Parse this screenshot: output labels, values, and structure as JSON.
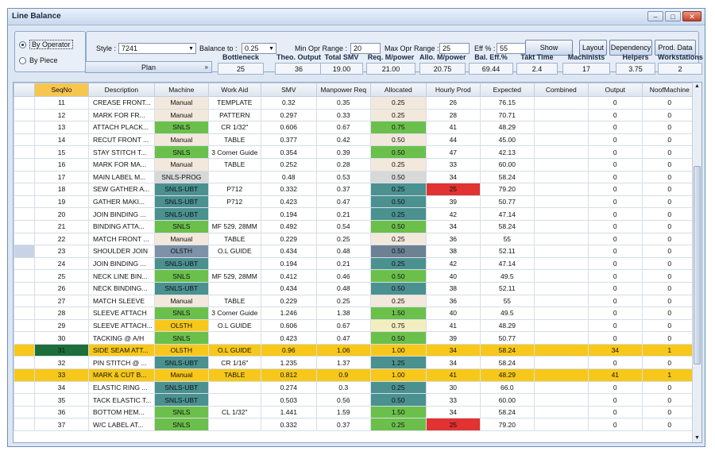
{
  "window": {
    "title": "Line Balance",
    "min": "–",
    "max": "□",
    "close": "✕"
  },
  "mode": {
    "op": "By Operator",
    "piece": "By Piece"
  },
  "filters": {
    "style_label": "Style :",
    "style_value": "7241",
    "balance_label": "Balance to :",
    "balance_value": "0.25",
    "min_label": "Min Opr Range :",
    "min_value": "20",
    "max_label": "Max Opr Range :",
    "max_value": "25",
    "eff_label": "Eff % :",
    "eff_value": "55",
    "show": "Show",
    "layout": "Layout",
    "dependency": "Dependency",
    "prod_data": "Prod. Data"
  },
  "plan": {
    "label": "Plan",
    "chev": "»"
  },
  "stats": [
    {
      "label": "Bottleneck",
      "value": "25"
    },
    {
      "label": "Theo. Output",
      "value": "36"
    },
    {
      "label": "Total SMV",
      "value": "19.00"
    },
    {
      "label": "Req. M/power",
      "value": "21.00"
    },
    {
      "label": "Allo. M/power",
      "value": "20.75"
    },
    {
      "label": "Bal. Eff.%",
      "value": "69.44"
    },
    {
      "label": "Takt Time",
      "value": "2.4"
    },
    {
      "label": "Machinists",
      "value": "17"
    },
    {
      "label": "Helpers",
      "value": "3.75"
    },
    {
      "label": "Workstations",
      "value": "2"
    }
  ],
  "columns": [
    "SeqNo",
    "Description",
    "Machine",
    "Work Aid",
    "SMV",
    "Manpower Req",
    "Allocated",
    "Hourly Prod",
    "Expected",
    "Combined",
    "Output",
    "NoofMachine"
  ],
  "rows": [
    [
      "11",
      "CREASE FRONT...",
      "Manual",
      "TEMPLATE",
      "0.32",
      "0.35",
      "0.25",
      "26",
      "76.15",
      "",
      "0",
      "0"
    ],
    [
      "12",
      "MARK FOR FR...",
      "Manual",
      "PATTERN",
      "0.297",
      "0.33",
      "0.25",
      "28",
      "70.71",
      "",
      "0",
      "0"
    ],
    [
      "13",
      "ATTACH PLACK...",
      "SNLS",
      "CR 1/32\"",
      "0.606",
      "0.67",
      "0.75",
      "41",
      "48.29",
      "",
      "0",
      "0"
    ],
    [
      "14",
      "RECUT FRONT ...",
      "Manual",
      "TABLE",
      "0.377",
      "0.42",
      "0.50",
      "44",
      "45.00",
      "",
      "0",
      "0"
    ],
    [
      "15",
      "STAY STITCH T...",
      "SNLS",
      "3 Corner Guide",
      "0.354",
      "0.39",
      "0.50",
      "47",
      "42.13",
      "",
      "0",
      "0"
    ],
    [
      "16",
      "MARK FOR MA...",
      "Manual",
      "TABLE",
      "0.252",
      "0.28",
      "0.25",
      "33",
      "60.00",
      "",
      "0",
      "0"
    ],
    [
      "17",
      "MAIN LABEL M...",
      "SNLS-PROG",
      "",
      "0.48",
      "0.53",
      "0.50",
      "34",
      "58.24",
      "",
      "0",
      "0"
    ],
    [
      "18",
      "SEW GATHER A...",
      "SNLS-UBT",
      "P712",
      "0.332",
      "0.37",
      "0.25",
      "25",
      "79.20",
      "",
      "0",
      "0"
    ],
    [
      "19",
      "GATHER MAKI...",
      "SNLS-UBT",
      "P712",
      "0.423",
      "0.47",
      "0.50",
      "39",
      "50.77",
      "",
      "0",
      "0"
    ],
    [
      "20",
      "JOIN BINDING ...",
      "SNLS-UBT",
      "",
      "0.194",
      "0.21",
      "0.25",
      "42",
      "47.14",
      "",
      "0",
      "0"
    ],
    [
      "21",
      "BINDING ATTA...",
      "SNLS",
      "MF 529, 28MM",
      "0.492",
      "0.54",
      "0.50",
      "34",
      "58.24",
      "",
      "0",
      "0"
    ],
    [
      "22",
      "MATCH FRONT ...",
      "Manual",
      "TABLE",
      "0.229",
      "0.25",
      "0.25",
      "36",
      "55",
      "",
      "0",
      "0"
    ],
    [
      "23",
      "SHOULDER JOIN",
      "OL5TH",
      "O.L GUIDE",
      "0.434",
      "0.48",
      "0.50",
      "38",
      "52.11",
      "",
      "0",
      "0"
    ],
    [
      "24",
      "JOIN BINDING ...",
      "SNLS-UBT",
      "",
      "0.194",
      "0.21",
      "0.25",
      "42",
      "47.14",
      "",
      "0",
      "0"
    ],
    [
      "25",
      "NECK LINE BIN...",
      "SNLS",
      "MF 529, 28MM",
      "0.412",
      "0.46",
      "0.50",
      "40",
      "49.5",
      "",
      "0",
      "0"
    ],
    [
      "26",
      "NECK BINDING...",
      "SNLS-UBT",
      "",
      "0.434",
      "0.48",
      "0.50",
      "38",
      "52.11",
      "",
      "0",
      "0"
    ],
    [
      "27",
      "MATCH SLEEVE",
      "Manual",
      "TABLE",
      "0.229",
      "0.25",
      "0.25",
      "36",
      "55",
      "",
      "0",
      "0"
    ],
    [
      "28",
      "SLEEVE ATTACH",
      "SNLS",
      "3 Corner Guide",
      "1.246",
      "1.38",
      "1.50",
      "40",
      "49.5",
      "",
      "0",
      "0"
    ],
    [
      "29",
      "SLEEVE ATTACH...",
      "OL5TH",
      "O.L GUIDE",
      "0.606",
      "0.67",
      "0.75",
      "41",
      "48.29",
      "",
      "0",
      "0"
    ],
    [
      "30",
      "TACKING @ A/H",
      "SNLS",
      "",
      "0.423",
      "0.47",
      "0.50",
      "39",
      "50.77",
      "",
      "0",
      "0"
    ],
    [
      "31",
      "SIDE SEAM ATT...",
      "OL5TH",
      "O.L GUIDE",
      "0.96",
      "1.06",
      "1.00",
      "34",
      "58.24",
      "",
      "34",
      "1"
    ],
    [
      "32",
      "PIN STITCH @ ...",
      "SNLS-UBT",
      "CR 1/16\"",
      "1.235",
      "1.37",
      "1.25",
      "34",
      "58.24",
      "",
      "0",
      "0"
    ],
    [
      "33",
      "MARK & CUT B...",
      "Manual",
      "TABLE",
      "0.812",
      "0.9",
      "1.00",
      "41",
      "48.29",
      "",
      "41",
      "1"
    ],
    [
      "34",
      "ELASTIC RING ...",
      "SNLS-UBT",
      "",
      "0.274",
      "0.3",
      "0.25",
      "30",
      "66.0",
      "",
      "0",
      "0"
    ],
    [
      "35",
      "TACK ELASTIC T...",
      "SNLS-UBT",
      "",
      "0.503",
      "0.56",
      "0.50",
      "33",
      "60.00",
      "",
      "0",
      "0"
    ],
    [
      "36",
      "BOTTOM HEM...",
      "SNLS",
      "CL 1/32\"",
      "1.441",
      "1.59",
      "1.50",
      "34",
      "58.24",
      "",
      "0",
      "0"
    ],
    [
      "37",
      "W/C LABEL AT...",
      "SNLS",
      "",
      "0.332",
      "0.37",
      "0.25",
      "25",
      "79.20",
      "",
      "0",
      "0"
    ]
  ],
  "colors": {
    "highlight_row": "#f7c81a",
    "bottleneck": "#e23232",
    "snls": "#6bc04b",
    "ubt": "#4a9190",
    "manual": "#f3e8dc",
    "selected_seq": "#1d6e3a"
  },
  "scroll": {
    "up": "▲",
    "down": "▼"
  }
}
